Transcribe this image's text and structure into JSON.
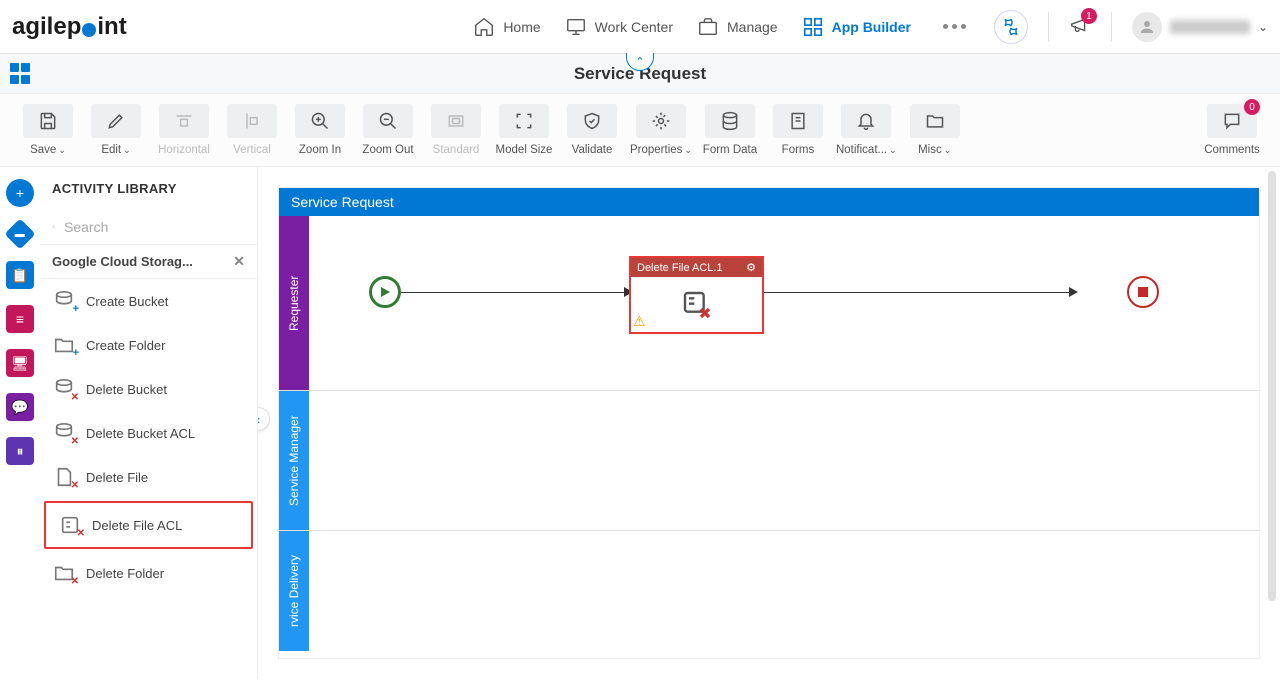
{
  "logo": "agilepoint",
  "nav": {
    "home": "Home",
    "work_center": "Work Center",
    "manage": "Manage",
    "app_builder": "App Builder"
  },
  "notif_count": "1",
  "page_title": "Service Request",
  "toolbar": {
    "save": "Save",
    "edit": "Edit",
    "horizontal": "Horizontal",
    "vertical": "Vertical",
    "zoom_in": "Zoom In",
    "zoom_out": "Zoom Out",
    "standard": "Standard",
    "model_size": "Model Size",
    "validate": "Validate",
    "properties": "Properties",
    "form_data": "Form Data",
    "forms": "Forms",
    "notifications": "Notificat...",
    "misc": "Misc",
    "comments": "Comments",
    "comments_count": "0"
  },
  "sidebar": {
    "title": "ACTIVITY LIBRARY",
    "search_placeholder": "Search",
    "category": "Google Cloud Storag...",
    "items": [
      "Create Bucket",
      "Create Folder",
      "Delete Bucket",
      "Delete Bucket ACL",
      "Delete File",
      "Delete File ACL",
      "Delete Folder"
    ]
  },
  "canvas": {
    "title": "Service Request",
    "lanes": [
      "Requester",
      "Service Manager",
      "rvice Delivery"
    ],
    "activity_title": "Delete File ACL.1"
  }
}
